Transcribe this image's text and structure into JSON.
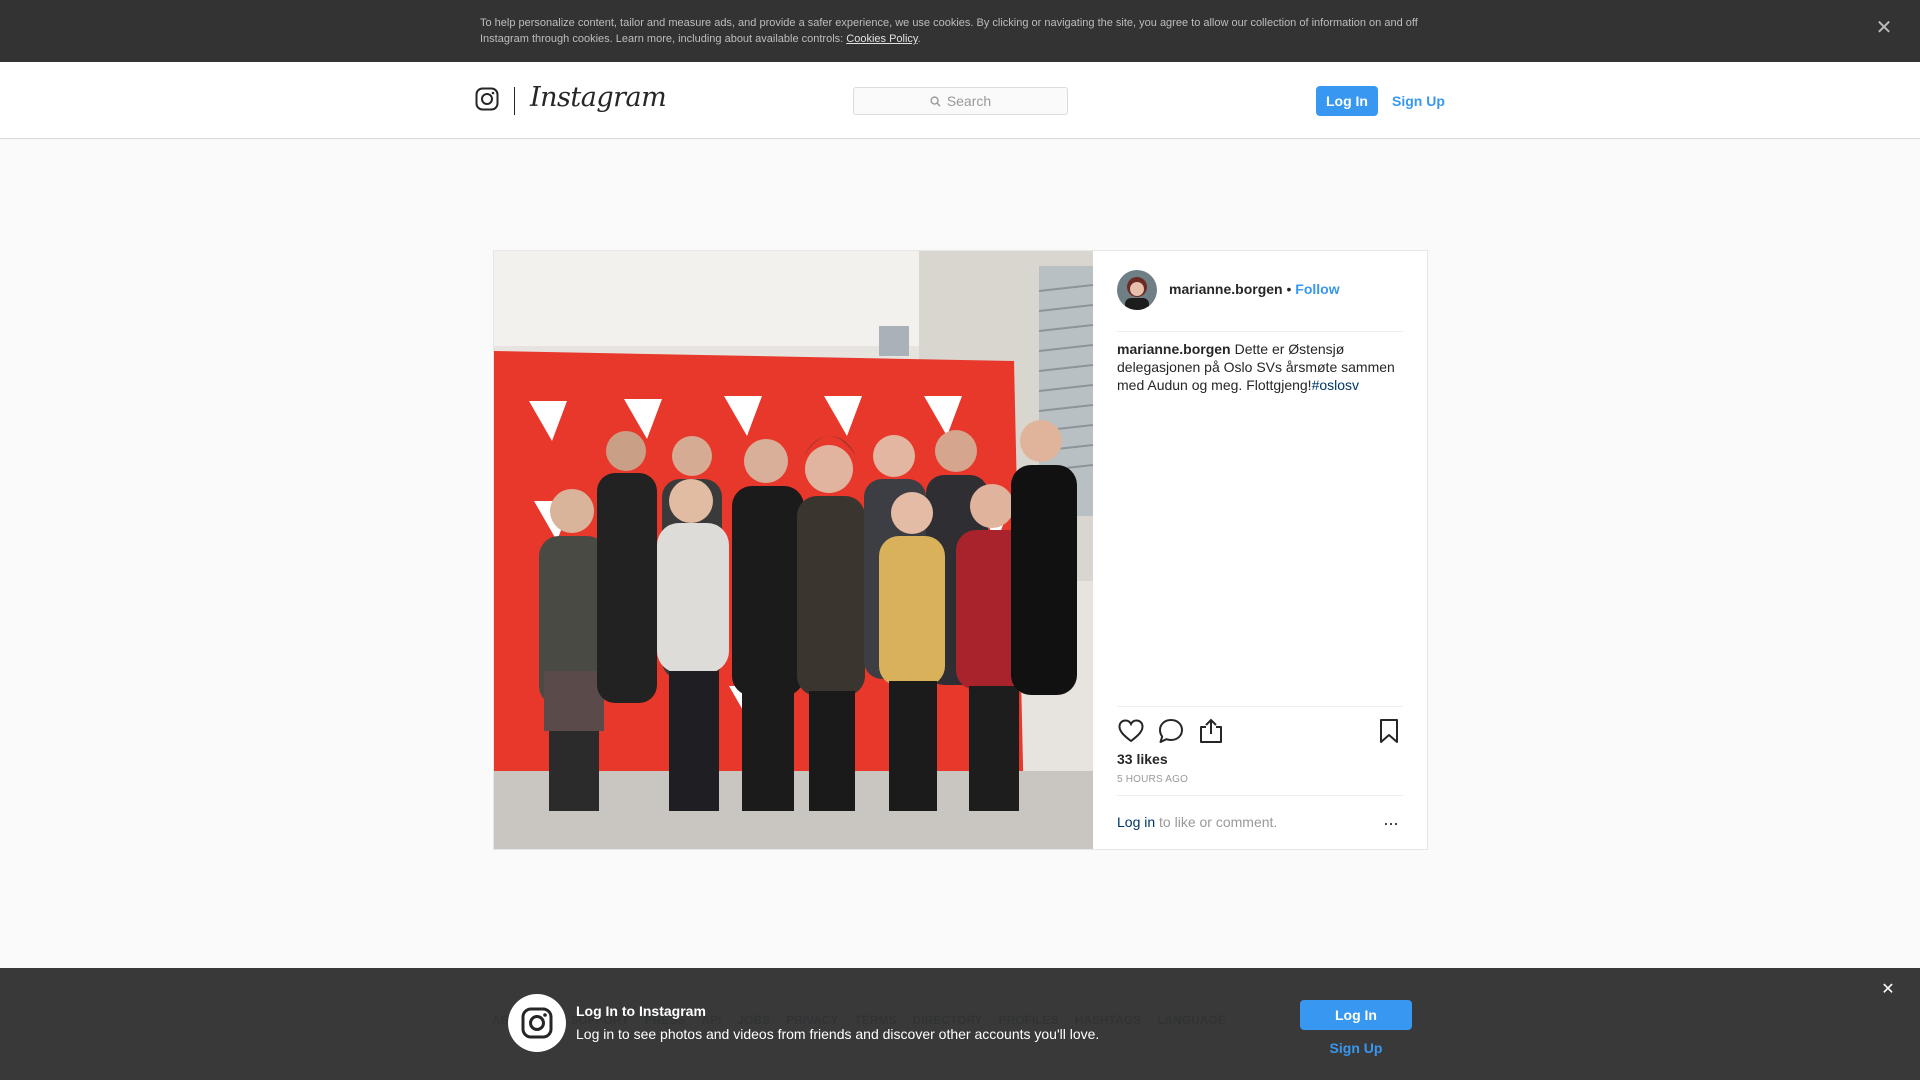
{
  "cookie_banner": {
    "text": "To help personalize content, tailor and measure ads, and provide a safer experience, we use cookies. By clicking or navigating the site, you agree to allow our collection of information on and off Instagram through cookies. Learn more, including about available controls: ",
    "link": "Cookies Policy",
    "suffix": ".",
    "close_icon": "close-icon"
  },
  "header": {
    "brand": "Instagram",
    "search_placeholder": "Search",
    "login_label": "Log In",
    "signup_label": "Sign Up"
  },
  "post": {
    "username": "marianne.borgen",
    "separator": " • ",
    "follow_label": "Follow",
    "caption_text": "Dette er Østensjø delegasjonen på Oslo SVs årsmøte sammen med Audun og meg. Flottgjeng!",
    "hashtag": "#oslosv",
    "likes": "33 likes",
    "time_ago": "5 HOURS AGO",
    "comment_login": "Log in",
    "comment_suffix": " to like or comment.",
    "more_label": "..."
  },
  "footer": {
    "links": [
      "ABOUT US",
      "SUPPORT",
      "PRESS",
      "API",
      "JOBS",
      "PRIVACY",
      "TERMS",
      "DIRECTORY",
      "PROFILES",
      "HASHTAGS",
      "LANGUAGE"
    ]
  },
  "bottom_bar": {
    "title": "Log In to Instagram",
    "subtitle": "Log in to see photos and videos from friends and discover other accounts you'll love.",
    "login_label": "Log In",
    "signup_label": "Sign Up"
  },
  "colors": {
    "accent": "#3897f0",
    "link_dark": "#003569",
    "banner_bg": "#333333"
  }
}
